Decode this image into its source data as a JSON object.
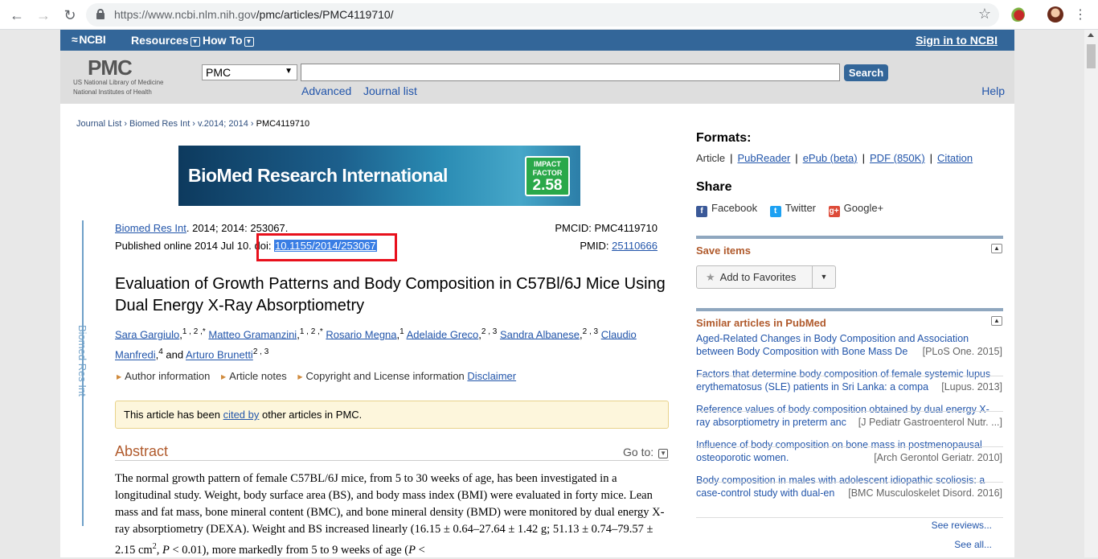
{
  "browser": {
    "url_host": "https://www.ncbi.nlm.nih.gov",
    "url_path": "/pmc/articles/PMC4119710/"
  },
  "ncbi": {
    "logo": "NCBI",
    "resources": "Resources",
    "howto": "How To",
    "signin": "Sign in to NCBI"
  },
  "search": {
    "pmc_logo": "PMC",
    "nlm_line1": "US National Library of Medicine",
    "nlm_line2": "National Institutes of Health",
    "db_selected": "PMC",
    "query": "",
    "search_button": "Search",
    "advanced": "Advanced",
    "journal_list": "Journal list",
    "help": "Help"
  },
  "breadcrumb": {
    "journal_list": "Journal List",
    "journal": "Biomed Res Int",
    "volume": "v.2014; 2014",
    "current": "PMC4119710"
  },
  "banner": {
    "journal_name": "BioMed Research International",
    "impact_label1": "IMPACT",
    "impact_label2": "FACTOR",
    "impact_value": "2.58"
  },
  "sidebar_tab": "Biomed Res Int",
  "citation": {
    "journal_link": "Biomed Res Int",
    "details": ". 2014; 2014: 253067.",
    "published": "Published online 2014 Jul 10.",
    "doi_label": "doi:",
    "doi_value": "10.1155/2014/253067",
    "pmcid": "PMCID: PMC4119710",
    "pmid_label": "PMID:",
    "pmid_value": "25110666"
  },
  "article": {
    "title": "Evaluation of Growth Patterns and Body Composition in C57Bl/6J Mice Using Dual Energy X-Ray Absorptiometry",
    "authors": [
      {
        "name": "Sara Gargiulo",
        "sup": "1 , 2 ,*"
      },
      {
        "name": "Matteo Gramanzini",
        "sup": "1 , 2 ,*"
      },
      {
        "name": "Rosario Megna",
        "sup": "1"
      },
      {
        "name": "Adelaide Greco",
        "sup": "2 , 3"
      },
      {
        "name": "Sandra Albanese",
        "sup": "2 , 3"
      },
      {
        "name": "Claudio Manfredi",
        "sup": "4"
      },
      {
        "name": "Arturo Brunetti",
        "sup": "2 , 3"
      }
    ],
    "and": "and",
    "info_links": {
      "author_info": "Author information",
      "article_notes": "Article notes",
      "copyright": "Copyright and License information",
      "disclaimer": "Disclaimer"
    },
    "notice_pre": "This article has been",
    "notice_link": "cited by",
    "notice_post": "other articles in PMC.",
    "abstract_heading": "Abstract",
    "goto": "Go to:",
    "abstract_text_1": "The normal growth pattern of female C57BL/6J mice, from 5 to 30 weeks of age, has been investigated in a longitudinal study. Weight, body surface area (BS), and body mass index (BMI) were evaluated in forty mice. Lean mass and fat mass, bone mineral content (BMC), and bone mineral density (BMD) were monitored by dual energy X-ray absorptiometry (DEXA). Weight and BS increased linearly (16.15 ± 0.64–27.64 ± 1.42 g; 51.13 ± 0.74–79.57 ± 2.15 cm",
    "abstract_text_2": ", more markedly from 5 to 9 weeks of age ("
  },
  "right": {
    "formats_title": "Formats:",
    "formats": [
      "Article",
      "PubReader",
      "ePub (beta)",
      "PDF (850K)",
      "Citation"
    ],
    "share_title": "Share",
    "share": [
      "Facebook",
      "Twitter",
      "Google+"
    ],
    "save_items_title": "Save items",
    "add_favorites": "Add to Favorites",
    "similar_title": "Similar articles in PubMed",
    "similar": [
      {
        "line1": "Aged-Related Changes in Body Composition and Association",
        "line2": "between Body Composition with Bone Mass De",
        "journal": "[PLoS One. 2015]"
      },
      {
        "line1": "Factors that determine body composition of female systemic lupus",
        "line2": "erythematosus (SLE) patients in Sri Lanka: a compa",
        "journal": "[Lupus. 2013]"
      },
      {
        "line1": "Reference values of body composition obtained by dual energy X-",
        "line2": "ray absorptiometry in preterm anc",
        "journal": "[J Pediatr Gastroenterol Nutr. ...]"
      },
      {
        "line1": "Influence of body composition on bone mass in postmenopausal",
        "line2": "osteoporotic women.",
        "journal": "[Arch Gerontol Geriatr. 2010]"
      },
      {
        "line1": "Body composition in males with adolescent idiopathic scoliosis: a",
        "line2": "case-control study with dual-en",
        "journal": "[BMC Musculoskelet Disord. 2016]"
      }
    ],
    "see_reviews": "See reviews...",
    "see_all": "See all..."
  }
}
